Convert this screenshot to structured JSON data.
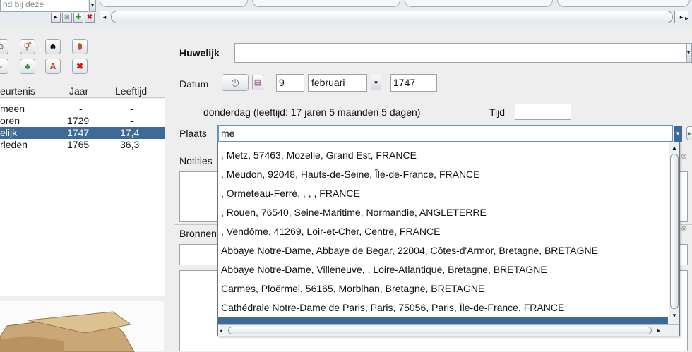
{
  "top": {
    "search_value": "nd bij deze"
  },
  "events": {
    "headers": [
      "eurtenis",
      "Jaar",
      "Leeftijd"
    ],
    "rows": [
      {
        "name": "meen",
        "year": "-",
        "age": "-",
        "selected": false
      },
      {
        "name": "oren",
        "year": "1729",
        "age": "-",
        "selected": false
      },
      {
        "name": "elijk",
        "year": "1747",
        "age": "17,4",
        "selected": true
      },
      {
        "name": "rleden",
        "year": "1765",
        "age": "36,3",
        "selected": false
      }
    ]
  },
  "form": {
    "title": "Huwelijk",
    "datum_label": "Datum",
    "day": "9",
    "month": "februari",
    "year": "1747",
    "weekday_info": "donderdag   (leeftijd: 17 jaren 5 maanden 5 dagen)",
    "tijd_label": "Tijd",
    "plaats_label": "Plaats",
    "plaats_value": "me",
    "notities_label": "Notities",
    "bronnen_label": "Bronnen"
  },
  "dropdown": {
    "items": [
      ", Metz, 57463, Mozelle, Grand Est, FRANCE",
      ", Meudon, 92048, Hauts-de-Seine, Île-de-France, FRANCE",
      ", Ormeteau-Ferré, , , , FRANCE",
      ", Rouen, 76540, Seine-Maritime, Normandie, ANGLETERRE",
      ", Vendôme, 41269, Loir-et-Cher, Centre, FRANCE",
      "Abbaye Notre-Dame, Abbaye de Begar, 22004, Côtes-d'Armor, Bretagne, BRETAGNE",
      "Abbaye Notre-Dame, Villeneuve, , Loire-Atlantique, Bretagne, BRETAGNE",
      "Carmes, Ploërmel, 56165, Morbihan, Bretagne, BRETAGNE",
      "Cathédrale Notre-Dame de Paris, Paris, 75056, Paris, Île-de-France, FRANCE"
    ]
  },
  "colors": {
    "selection": "#3d6a96",
    "background": "#eeeeee"
  }
}
